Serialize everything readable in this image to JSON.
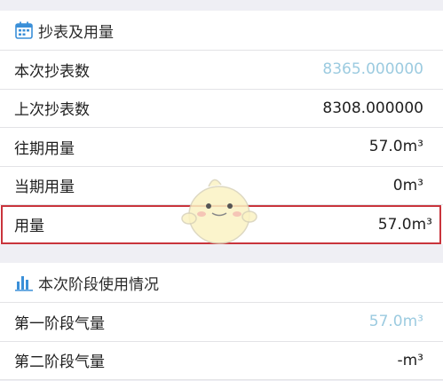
{
  "reading": {
    "title": "抄表及用量",
    "rows": [
      {
        "label": "本次抄表数",
        "value": "8365.000000"
      },
      {
        "label": "上次抄表数",
        "value": "8308.000000"
      },
      {
        "label": "往期用量",
        "value": "57.0m³"
      },
      {
        "label": "当期用量",
        "value": "0m³"
      },
      {
        "label": "用量",
        "value": "57.0m³"
      }
    ]
  },
  "stage": {
    "title": "本次阶段使用情况",
    "rows": [
      {
        "label": "第一阶段气量",
        "value": "57.0m³"
      },
      {
        "label": "第二阶段气量",
        "value": "-m³"
      }
    ]
  },
  "colors": {
    "accent_value": "#9ccbe0",
    "highlight_border": "#c9343c",
    "icon_blue": "#3a8fd8"
  }
}
